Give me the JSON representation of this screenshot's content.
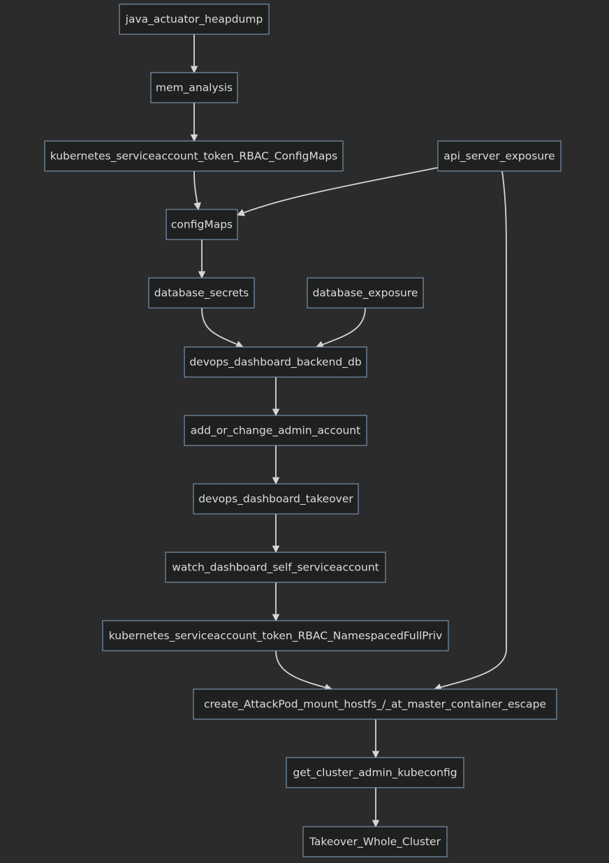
{
  "diagram": {
    "type": "flowchart",
    "direction": "top-down",
    "colors": {
      "background": "#2b2b2b",
      "node_fill": "#1f2020",
      "node_border": "#7893ad",
      "node_text": "#dcdcdc",
      "edge": "#d6d6d6"
    },
    "nodes": [
      {
        "id": "java_actuator_heapdump",
        "label": "java_actuator_heapdump"
      },
      {
        "id": "mem_analysis",
        "label": "mem_analysis"
      },
      {
        "id": "kubernetes_serviceaccount_token_RBAC_ConfigMaps",
        "label": "kubernetes_serviceaccount_token_RBAC_ConfigMaps"
      },
      {
        "id": "api_server_exposure",
        "label": "api_server_exposure"
      },
      {
        "id": "configMaps",
        "label": "configMaps"
      },
      {
        "id": "database_secrets",
        "label": "database_secrets"
      },
      {
        "id": "database_exposure",
        "label": "database_exposure"
      },
      {
        "id": "devops_dashboard_backend_db",
        "label": "devops_dashboard_backend_db"
      },
      {
        "id": "add_or_change_admin_account",
        "label": "add_or_change_admin_account"
      },
      {
        "id": "devops_dashboard_takeover",
        "label": "devops_dashboard_takeover"
      },
      {
        "id": "watch_dashboard_self_serviceaccount",
        "label": "watch_dashboard_self_serviceaccount"
      },
      {
        "id": "kubernetes_serviceaccount_token_RBAC_NamespacedFullPriv",
        "label": "kubernetes_serviceaccount_token_RBAC_NamespacedFullPriv"
      },
      {
        "id": "create_AttackPod_mount_hostfs_at_master_container_escape",
        "label": "create_AttackPod_mount_hostfs_/_at_master_container_escape"
      },
      {
        "id": "get_cluster_admin_kubeconfig",
        "label": "get_cluster_admin_kubeconfig"
      },
      {
        "id": "Takeover_Whole_Cluster",
        "label": "Takeover_Whole_Cluster"
      }
    ],
    "edges": [
      {
        "from": "java_actuator_heapdump",
        "to": "mem_analysis"
      },
      {
        "from": "mem_analysis",
        "to": "kubernetes_serviceaccount_token_RBAC_ConfigMaps"
      },
      {
        "from": "kubernetes_serviceaccount_token_RBAC_ConfigMaps",
        "to": "configMaps"
      },
      {
        "from": "api_server_exposure",
        "to": "configMaps"
      },
      {
        "from": "api_server_exposure",
        "to": "create_AttackPod_mount_hostfs_at_master_container_escape"
      },
      {
        "from": "configMaps",
        "to": "database_secrets"
      },
      {
        "from": "database_secrets",
        "to": "devops_dashboard_backend_db"
      },
      {
        "from": "database_exposure",
        "to": "devops_dashboard_backend_db"
      },
      {
        "from": "devops_dashboard_backend_db",
        "to": "add_or_change_admin_account"
      },
      {
        "from": "add_or_change_admin_account",
        "to": "devops_dashboard_takeover"
      },
      {
        "from": "devops_dashboard_takeover",
        "to": "watch_dashboard_self_serviceaccount"
      },
      {
        "from": "watch_dashboard_self_serviceaccount",
        "to": "kubernetes_serviceaccount_token_RBAC_NamespacedFullPriv"
      },
      {
        "from": "kubernetes_serviceaccount_token_RBAC_NamespacedFullPriv",
        "to": "create_AttackPod_mount_hostfs_at_master_container_escape"
      },
      {
        "from": "create_AttackPod_mount_hostfs_at_master_container_escape",
        "to": "get_cluster_admin_kubeconfig"
      },
      {
        "from": "get_cluster_admin_kubeconfig",
        "to": "Takeover_Whole_Cluster"
      }
    ]
  }
}
